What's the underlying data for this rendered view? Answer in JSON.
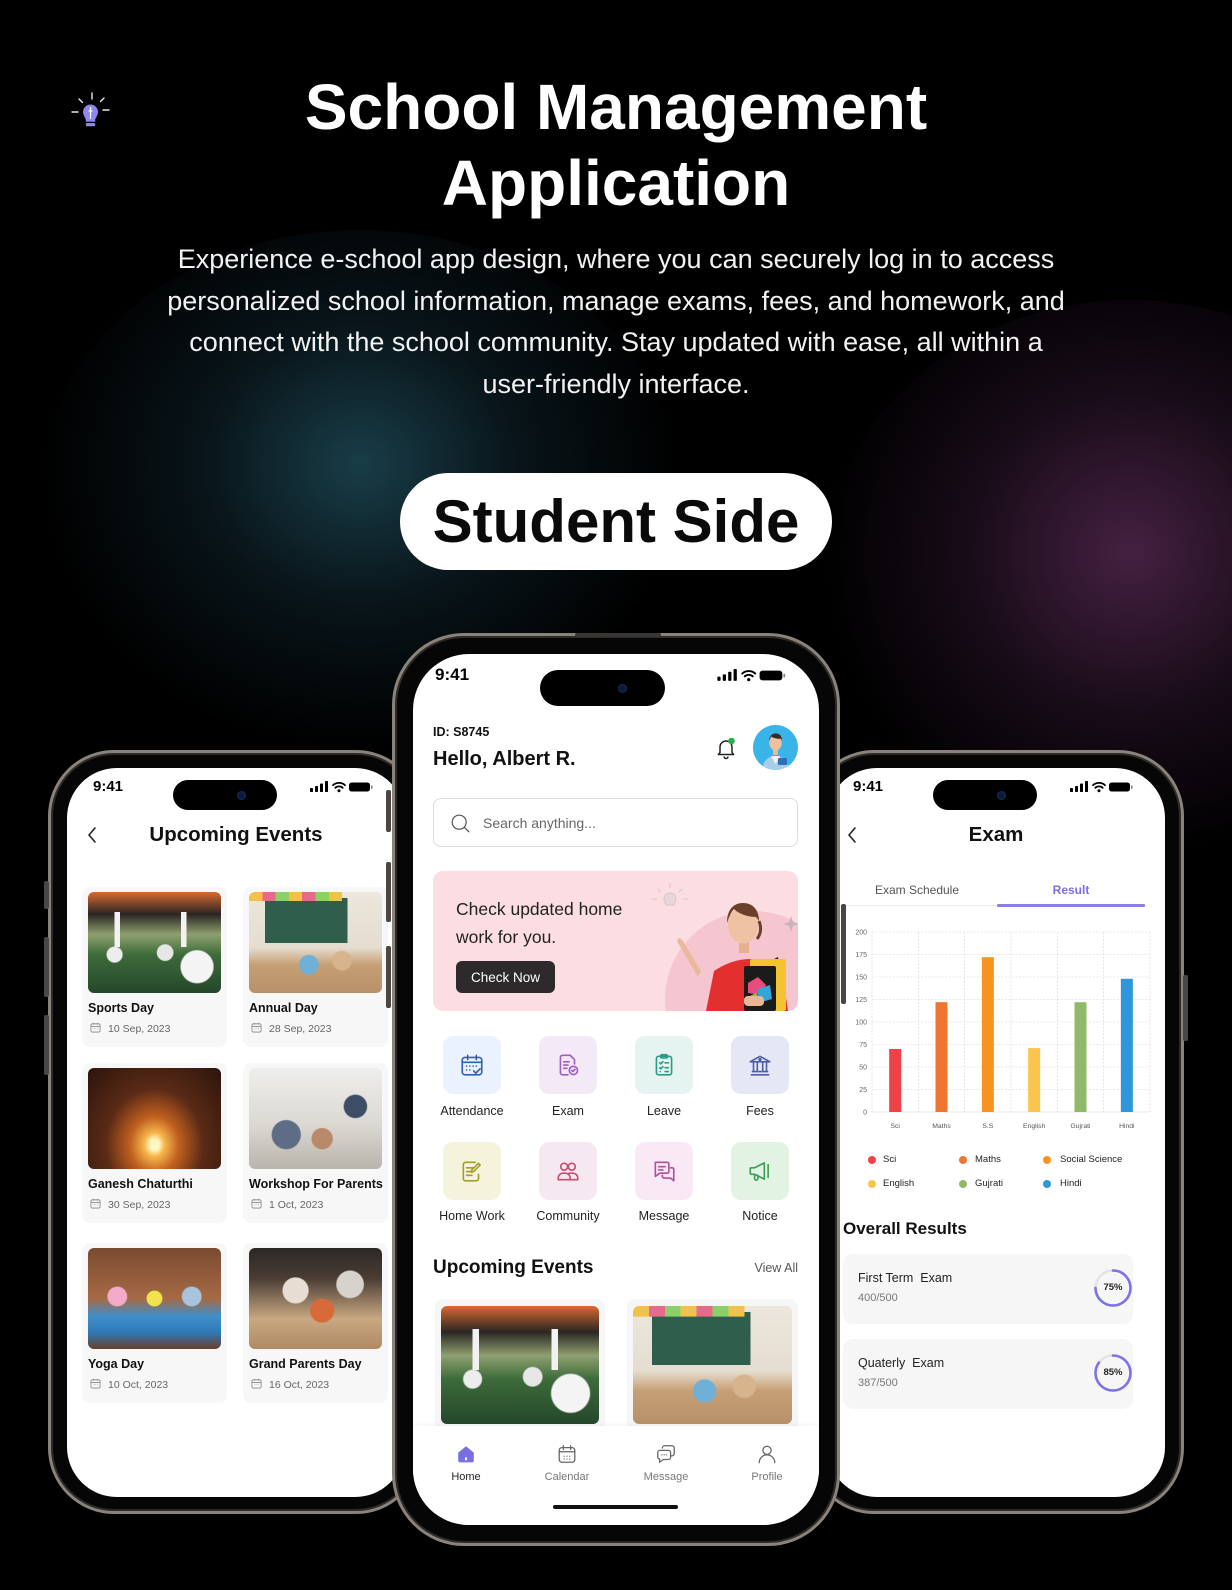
{
  "theme": {
    "accent": "#7b6fe0",
    "background": "#000000"
  },
  "header": {
    "logo_icon": "lightbulb-icon",
    "title_lines": [
      "School Management",
      "Application"
    ],
    "description_lines": [
      "Experience e-school app design, where you can securely log in to access",
      "personalized school information, manage exams, fees, and homework, and",
      "connect with the school community. Stay updated with ease, all within a",
      "user-friendly interface."
    ],
    "badge": "Student Side"
  },
  "events_screen": {
    "time": "9:41",
    "back_icon": "chevron-left-icon",
    "title": "Upcoming Events",
    "events": [
      {
        "title": "Sports Day",
        "date": "10 Sep, 2023",
        "photo": "sports-day-photo"
      },
      {
        "title": "Annual Day",
        "date": "28 Sep, 2023",
        "photo": "classroom-photo"
      },
      {
        "title": "Ganesh Chaturthi",
        "date": "30 Sep, 2023",
        "photo": "diya-lamp-photo"
      },
      {
        "title": "Workshop For Parents",
        "date": "1 Oct, 2023",
        "photo": "workshop-photo"
      },
      {
        "title": "Yoga Day",
        "date": "10 Oct, 2023",
        "photo": "yoga-photo"
      },
      {
        "title": "Grand Parents Day",
        "date": "16 Oct, 2023",
        "photo": "grandparents-photo"
      }
    ]
  },
  "home_screen": {
    "time": "9:41",
    "student_id": "ID: S8745",
    "greeting": "Hello, Albert R.",
    "search_placeholder": "Search anything...",
    "search_value": "",
    "banner": {
      "text_lines": [
        "Check updated home",
        "work for you."
      ],
      "button": "Check Now"
    },
    "menu": [
      {
        "label": "Attendance",
        "icon": "calendar-check-icon"
      },
      {
        "label": "Exam",
        "icon": "exam-document-icon"
      },
      {
        "label": "Leave",
        "icon": "clipboard-list-icon"
      },
      {
        "label": "Fees",
        "icon": "bank-icon"
      },
      {
        "label": "Home Work",
        "icon": "homework-pen-icon"
      },
      {
        "label": "Community",
        "icon": "community-people-icon"
      },
      {
        "label": "Message",
        "icon": "message-bubbles-icon"
      },
      {
        "label": "Notice",
        "icon": "megaphone-icon"
      }
    ],
    "events_section": {
      "title": "Upcoming Events",
      "view_all": "View All"
    },
    "nav": [
      {
        "label": "Home",
        "icon": "home-icon",
        "active": true
      },
      {
        "label": "Calendar",
        "icon": "calendar-icon",
        "active": false
      },
      {
        "label": "Message",
        "icon": "chat-icon",
        "active": false
      },
      {
        "label": "Profile",
        "icon": "profile-icon",
        "active": false
      }
    ]
  },
  "exam_screen": {
    "time": "9:41",
    "title": "Exam",
    "tabs": [
      {
        "label": "Exam Schedule",
        "active": false
      },
      {
        "label": "Result",
        "active": true
      }
    ],
    "overall_title": "Overall Results",
    "results": [
      {
        "name": "First Term  Exam",
        "score": "400/500",
        "percent": 75,
        "percent_label": "75%"
      },
      {
        "name": "Quaterly  Exam",
        "score": "387/500",
        "percent": 85,
        "percent_label": "85%"
      }
    ]
  },
  "chart_data": {
    "type": "bar",
    "title": "",
    "xlabel": "",
    "ylabel": "",
    "categories": [
      "Sci",
      "Maths",
      "S.S",
      "English",
      "Gujrati",
      "Hindi"
    ],
    "values": [
      70,
      122,
      172,
      71,
      122,
      148
    ],
    "colors": [
      "#f0414b",
      "#f07532",
      "#f7941f",
      "#f9c54d",
      "#8fbb69",
      "#2d97d9"
    ],
    "ylim": [
      0,
      200
    ],
    "yticks": [
      0,
      25,
      50,
      75,
      100,
      125,
      150,
      175,
      200
    ],
    "grid": true,
    "legend_position": "bottom",
    "legend": [
      {
        "label": "Sci",
        "color": "#f0414b"
      },
      {
        "label": "Maths",
        "color": "#f07532"
      },
      {
        "label": "Social Science",
        "color": "#f7941f"
      },
      {
        "label": "English",
        "color": "#f9c54d"
      },
      {
        "label": "Gujrati",
        "color": "#8fbb69"
      },
      {
        "label": "Hindi",
        "color": "#2d97d9"
      }
    ]
  }
}
